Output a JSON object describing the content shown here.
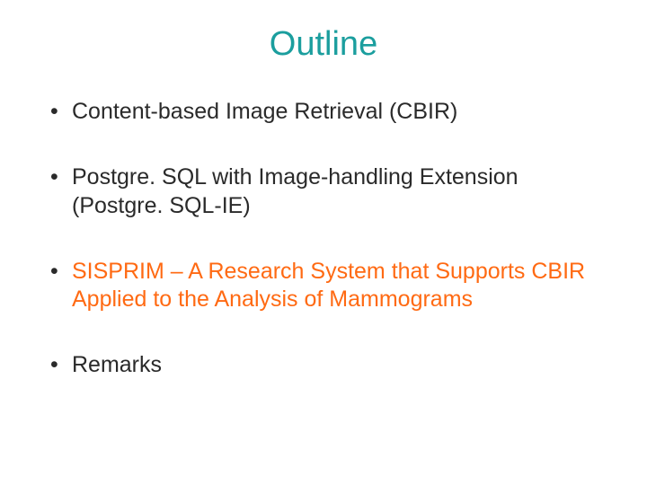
{
  "title": "Outline",
  "bullets": [
    {
      "text": "Content-based Image Retrieval (CBIR)",
      "highlight": false
    },
    {
      "text": "Postgre. SQL with Image-handling Extension (Postgre. SQL-IE)",
      "highlight": false
    },
    {
      "text": "SISPRIM – A Research System that Supports CBIR Applied to the Analysis of Mammograms",
      "highlight": true
    },
    {
      "text": "Remarks",
      "highlight": false
    }
  ]
}
